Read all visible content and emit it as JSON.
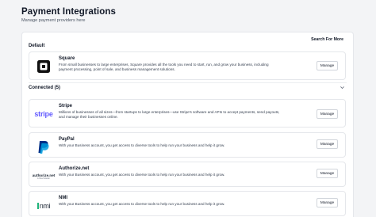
{
  "header": {
    "title": "Payment Integrations",
    "subtitle": "Manage payment providers here"
  },
  "panel": {
    "search_more": "Search For More",
    "default_section": "Default",
    "connected_section": "Connected (5)"
  },
  "providers": [
    {
      "name": "Square",
      "logo": "square-logo-icon",
      "description": "From small businesses to large enterprises, Square provides all the tools you need to start, run, and grow your business, including payment processing, point of sale, and business management solutions.",
      "action": "Manage"
    },
    {
      "name": "Stripe",
      "logo": "stripe-logo-icon",
      "logo_text": "stripe",
      "description": "Millions of businesses of all sizes—from startups to large enterprises—use Stripe's software and APIs to accept payments, send payouts, and manage their businesses online.",
      "action": "Manage"
    },
    {
      "name": "PayPal",
      "logo": "paypal-logo-icon",
      "description": "With your Business account, you get access to diverse tools to help run your business and help it grow.",
      "action": "Manage"
    },
    {
      "name": "Authorize.net",
      "logo": "authorize-net-logo-icon",
      "logo_text": "authorize.net",
      "logo_subtext": "A Visa Solution",
      "description": "With your Business account, you get access to diverse tools to help run your business and help it grow.",
      "action": "Manage"
    },
    {
      "name": "NMI",
      "logo": "nmi-logo-icon",
      "logo_text": "nmi",
      "description": "With your Business account, you get access to diverse tools to help run your business and help it grow.",
      "action": "Manage"
    }
  ],
  "colors": {
    "stripe": "#635bff",
    "paypal_dark": "#003087",
    "paypal_light": "#009cde",
    "nmi_green": "#1fb57a"
  }
}
